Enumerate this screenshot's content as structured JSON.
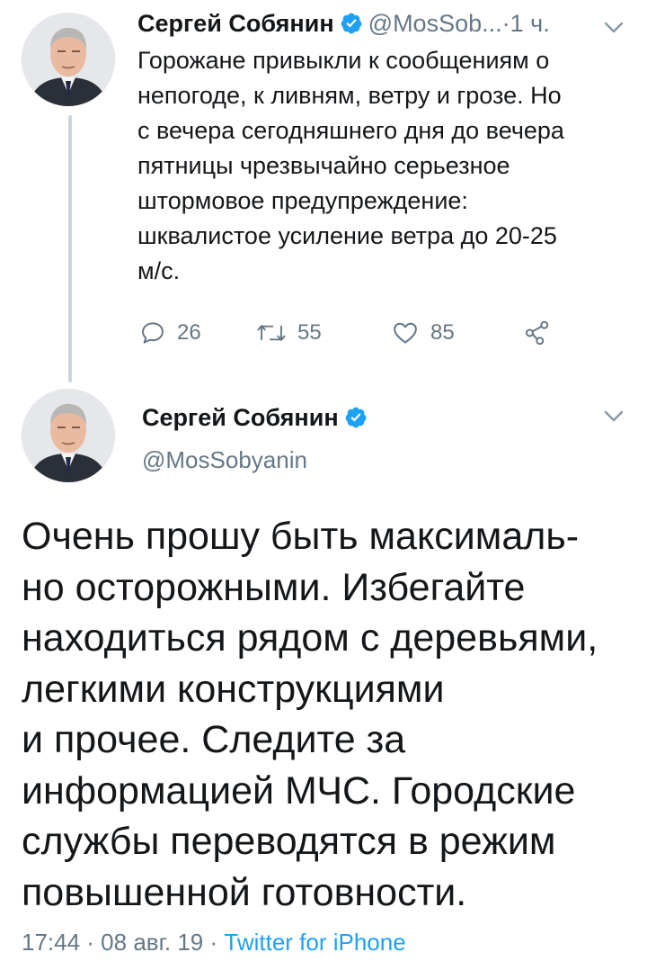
{
  "tweet1": {
    "author_name": "Сергей Собянин",
    "handle": "@MosSob...",
    "separator": " · ",
    "time": "1 ч.",
    "text": "Горожане привыкли к сообщениям о\nнепогоде, к ливням, ветру и грозе. Но\nс вечера сегодняшнего дня до вечера\nпятницы чрезвычайно серьезное\nштормовое предупреждение:\nшквалистое усиление ветра до 20-25\nм/с.",
    "actions": {
      "reply_count": "26",
      "retweet_count": "55",
      "like_count": "85",
      "reply_icon": "reply-icon",
      "retweet_icon": "retweet-icon",
      "like_icon": "heart-icon",
      "share_icon": "share-icon"
    }
  },
  "tweet2": {
    "author_name": "Сергей Собянин",
    "handle": "@MosSobyanin",
    "text": "Очень прошу быть максималь-\nно осторожными. Избегайте\nнаходиться рядом с деревьями,\nлегкими конструкциями\nи прочее. Следите за\nинформацией МЧС. Городские\nслужбы переводятся в режим\nповышенной готовности.",
    "timestamp": "17:44 · 08 авг. 19 · ",
    "source": "Twitter for iPhone"
  },
  "colors": {
    "text": "#14171a",
    "secondary": "#657786",
    "link": "#1da1f2",
    "verified": "#1da1f2",
    "thread_line": "#ccd6dd"
  }
}
